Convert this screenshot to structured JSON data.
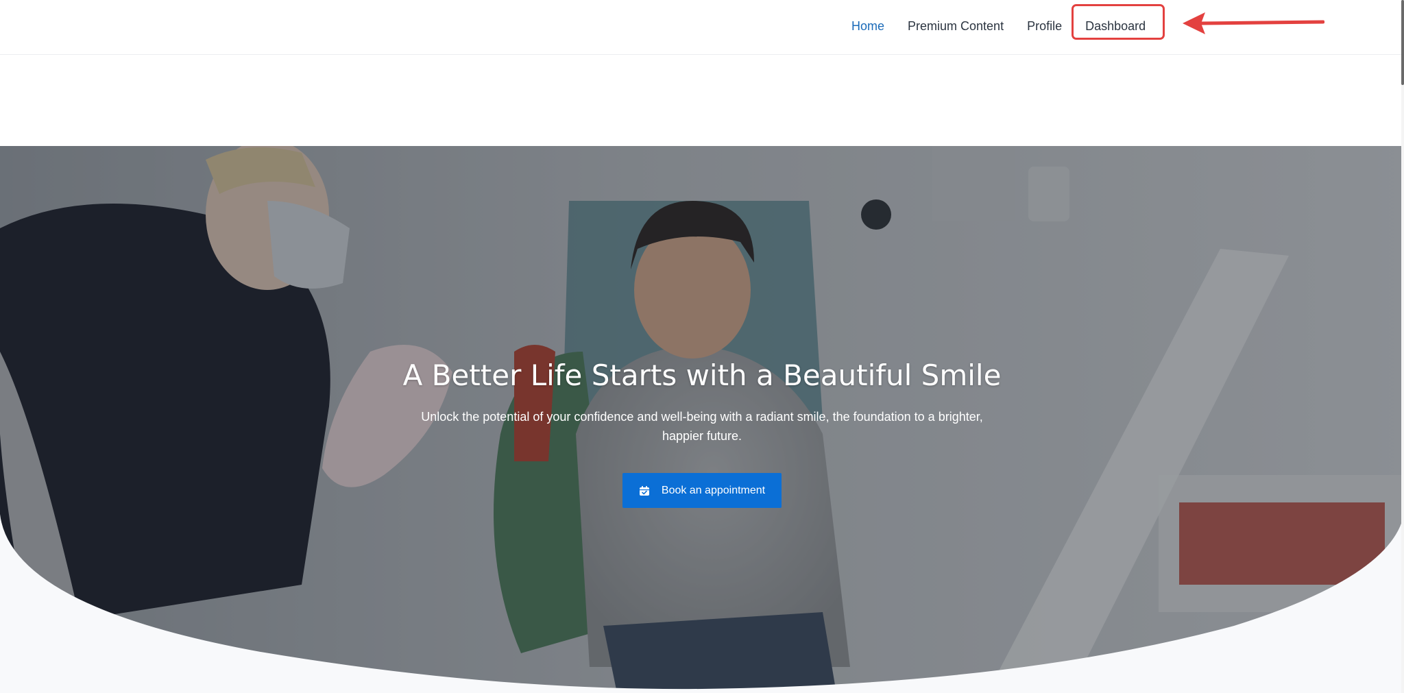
{
  "nav": {
    "items": [
      {
        "label": "Home",
        "active": true
      },
      {
        "label": "Premium Content",
        "active": false
      },
      {
        "label": "Profile",
        "active": false
      },
      {
        "label": "Dashboard",
        "active": false
      }
    ]
  },
  "hero": {
    "title": "A Better Life Starts with a Beautiful Smile",
    "subtitle": "Unlock the potential of your confidence and well-being with a radiant smile, the foundation to a brighter, happier future.",
    "cta": {
      "label": "Book an appointment",
      "icon": "calendar-check-icon"
    }
  },
  "annotation": {
    "highlighted_item": "Dashboard",
    "color": "#e3413f"
  },
  "colors": {
    "accent": "#0b6fd6",
    "nav_active": "#1a6ab8",
    "nav_text": "#2b3440",
    "section_bg": "#f8f9fb"
  }
}
